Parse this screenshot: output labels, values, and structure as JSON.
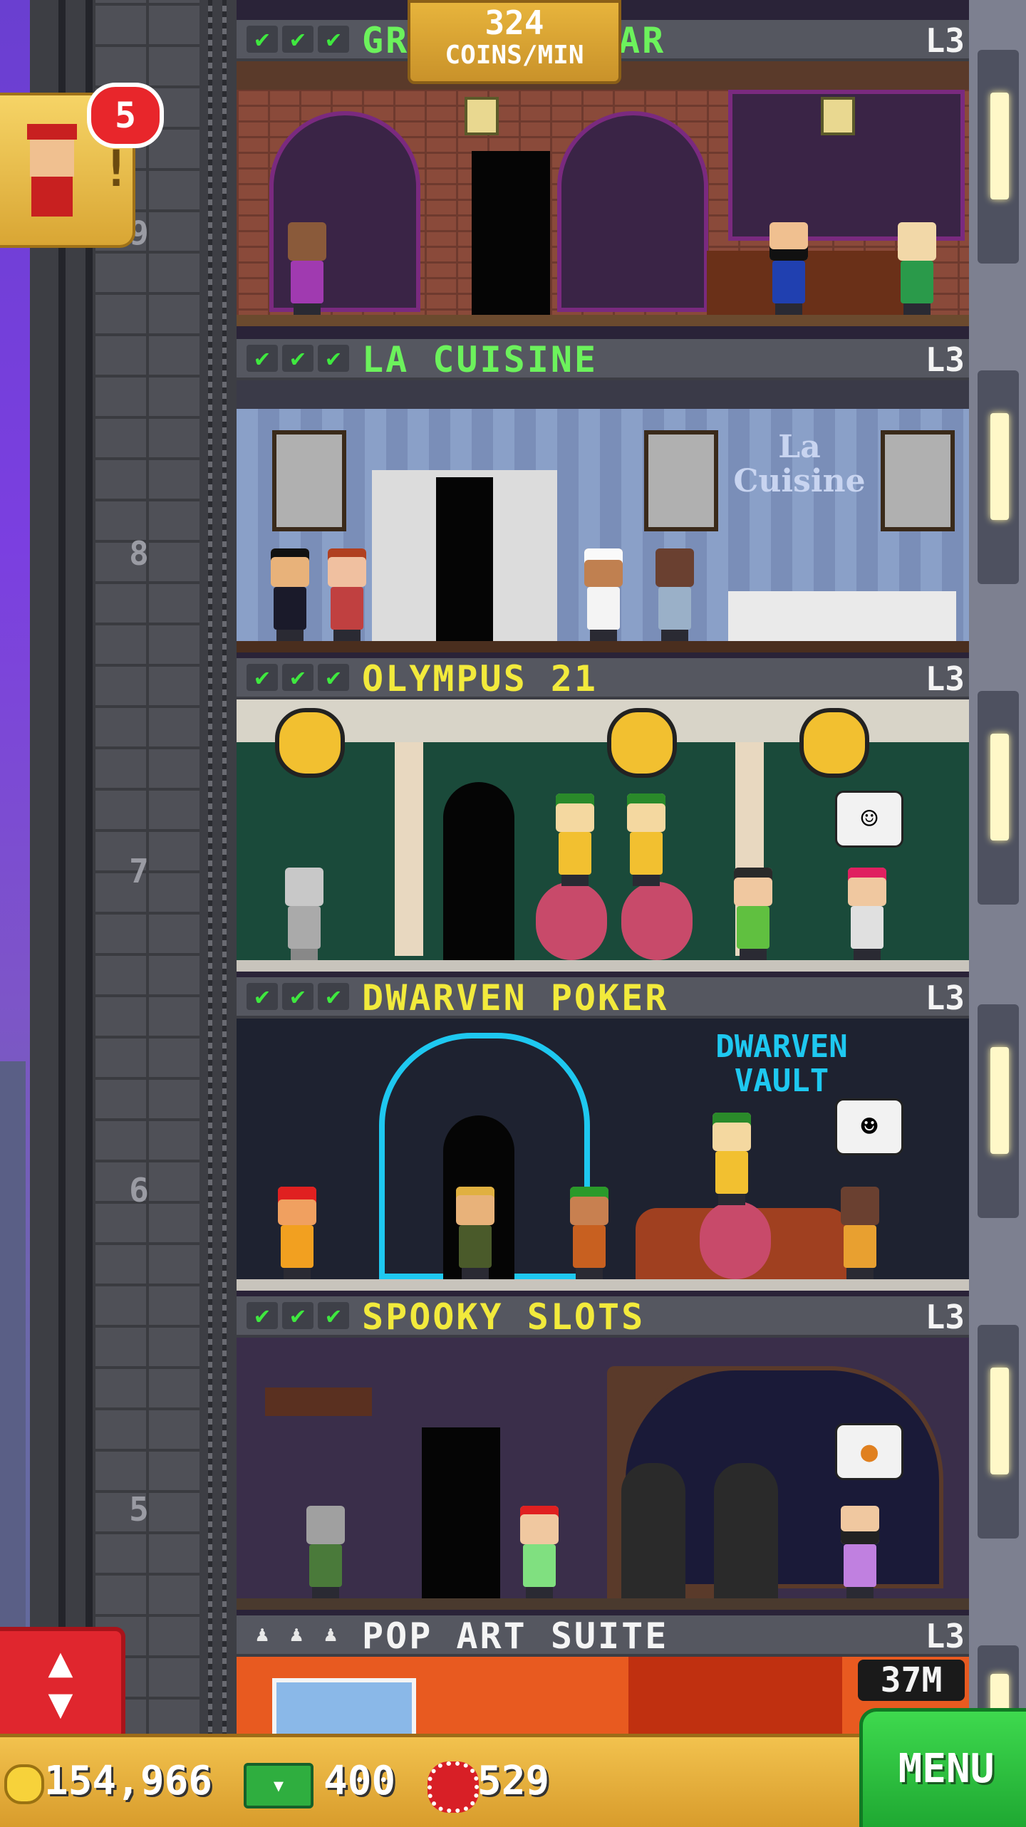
{
  "coins_rate": {
    "value": "324",
    "label": "COINS/MIN"
  },
  "bellhop": {
    "badge_count": "5",
    "exclamation": "!"
  },
  "floors": [
    {
      "name": "GRAND BAR",
      "visible_name_left": "GR",
      "visible_name_right": "AR",
      "level": "L3",
      "floor_number": "9",
      "name_color": "#6cf25c",
      "stocked": 3
    },
    {
      "name": "LA CUISINE",
      "level": "L3",
      "floor_number": "8",
      "name_color": "#6cf25c",
      "stocked": 3,
      "sign_line1": "La",
      "sign_line2": "Cuisine"
    },
    {
      "name": "OLYMPUS 21",
      "level": "L3",
      "floor_number": "7",
      "name_color": "#f2ea3c",
      "stocked": 3
    },
    {
      "name": "DWARVEN POKER",
      "level": "L3",
      "floor_number": "6",
      "name_color": "#f2ea3c",
      "stocked": 3,
      "sign_line1": "DWARVEN",
      "sign_line2": "VAULT"
    },
    {
      "name": "SPOOKY SLOTS",
      "level": "L3",
      "floor_number": "5",
      "name_color": "#f2ea3c",
      "stocked": 3
    },
    {
      "name": "POP ART SUITE",
      "level": "L3",
      "name_color": "#f4f4f4",
      "residents": 3
    }
  ],
  "check_icon": "check-mark",
  "person_icon": "person-silhouette",
  "pop_art_timer": "37M",
  "elevator_button": {
    "up": "▲",
    "down": "▼"
  },
  "bottom_bar": {
    "coins": "154,966",
    "bux": "400",
    "chips": "529",
    "menu_label": "MENU"
  },
  "colors": {
    "coin_gold": "#e7b43c",
    "menu_green": "#2fc341",
    "alert_red": "#e0262e",
    "shaft_gray": "#4f5057"
  }
}
